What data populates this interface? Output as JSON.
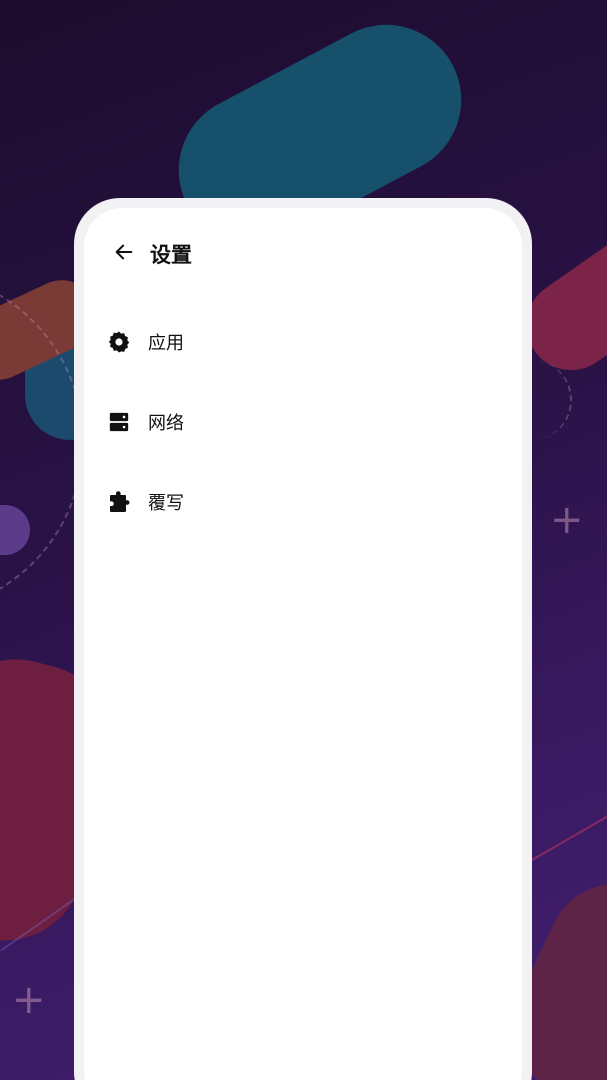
{
  "header": {
    "title": "设置",
    "back_icon": "arrow-left-icon"
  },
  "menu": {
    "items": [
      {
        "label": "应用",
        "icon": "gear-icon"
      },
      {
        "label": "网络",
        "icon": "server-icon"
      },
      {
        "label": "覆写",
        "icon": "puzzle-icon"
      }
    ]
  },
  "colors": {
    "panel_background": "#ffffff",
    "panel_border": "#f2f2f4",
    "text": "#111111",
    "background_dark": "#1c0d2e",
    "background_purple": "#43206d"
  }
}
